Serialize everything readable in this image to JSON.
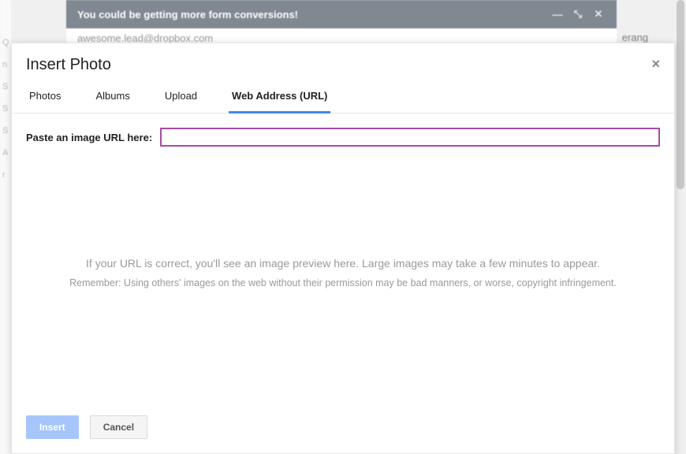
{
  "background": {
    "banner_text": "You could be getting more form conversions!",
    "email": "awesome.lead@dropbox.com",
    "right_word": "erang",
    "sidebar_letters": [
      "Q",
      "",
      "n",
      "S",
      "S",
      "S",
      "",
      "A",
      "r"
    ]
  },
  "modal": {
    "title": "Insert Photo",
    "close_glyph": "×",
    "tabs": [
      {
        "id": "photos",
        "label": "Photos",
        "active": false
      },
      {
        "id": "albums",
        "label": "Albums",
        "active": false
      },
      {
        "id": "upload",
        "label": "Upload",
        "active": false
      },
      {
        "id": "url",
        "label": "Web Address (URL)",
        "active": true
      }
    ],
    "url": {
      "label": "Paste an image URL here:",
      "value": "",
      "placeholder": ""
    },
    "hints": {
      "line1": "If your URL is correct, you'll see an image preview here. Large images may take a few minutes to appear.",
      "line2": "Remember: Using others' images on the web without their permission may be bad manners, or worse, copyright infringement."
    },
    "buttons": {
      "insert": "Insert",
      "cancel": "Cancel"
    }
  }
}
